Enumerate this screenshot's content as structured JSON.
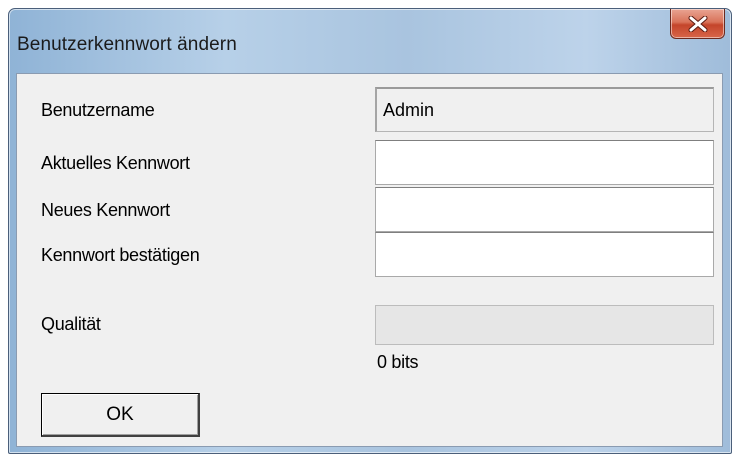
{
  "window": {
    "title": "Benutzerkennwort ändern",
    "close_icon": "close-x-icon"
  },
  "form": {
    "username_label": "Benutzername",
    "username_value": "Admin",
    "current_password_label": "Aktuelles Kennwort",
    "current_password_value": "",
    "new_password_label": "Neues Kennwort",
    "new_password_value": "",
    "confirm_password_label": "Kennwort bestätigen",
    "confirm_password_value": "",
    "quality_label": "Qualität",
    "quality_level": 0,
    "quality_bits_text": "0 bits"
  },
  "buttons": {
    "ok_label": "OK"
  },
  "colors": {
    "close_button": "#c4452b",
    "quality_fill": "#06b025"
  }
}
